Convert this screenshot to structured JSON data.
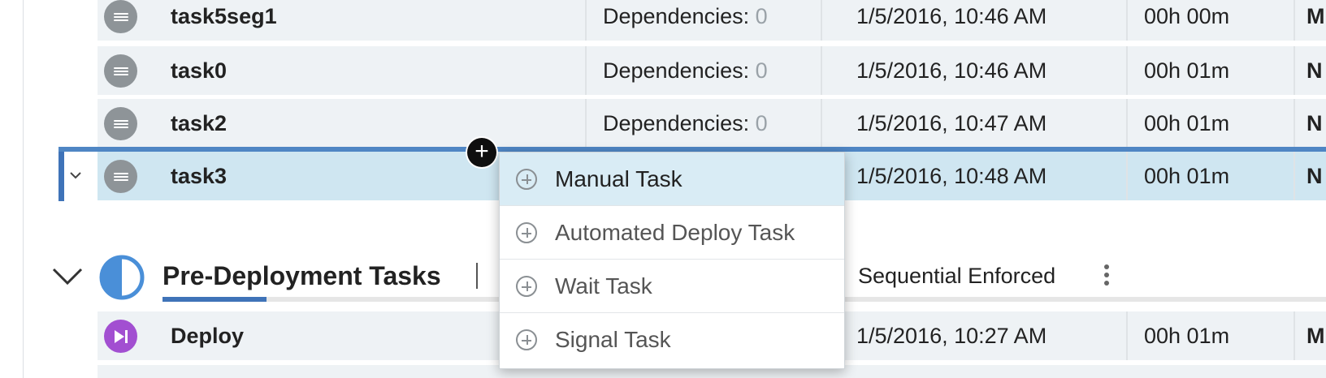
{
  "rows": [
    {
      "name": "task5seg1",
      "dependencies_label": "Dependencies:",
      "dependencies_count": "0",
      "timestamp": "1/5/2016, 10:46 AM",
      "duration": "00h 00m",
      "trailing": "M"
    },
    {
      "name": "task0",
      "dependencies_label": "Dependencies:",
      "dependencies_count": "0",
      "timestamp": "1/5/2016, 10:46 AM",
      "duration": "00h 01m",
      "trailing": "N"
    },
    {
      "name": "task2",
      "dependencies_label": "Dependencies:",
      "dependencies_count": "0",
      "timestamp": "1/5/2016, 10:47 AM",
      "duration": "00h 01m",
      "trailing": "N"
    },
    {
      "name": "task3",
      "timestamp": "1/5/2016, 10:48 AM",
      "duration": "00h 01m",
      "trailing": "N"
    }
  ],
  "group": {
    "title": "Pre-Deployment Tasks",
    "mode": "Sequential Enforced"
  },
  "deploy_row": {
    "name": "Deploy",
    "timestamp": "1/5/2016, 10:27 AM",
    "duration": "00h 01m",
    "trailing": "M"
  },
  "drop_indicator": {
    "symbol": "+"
  },
  "context_menu": {
    "items": [
      {
        "label": "Manual Task"
      },
      {
        "label": "Automated Deploy Task"
      },
      {
        "label": "Wait Task"
      },
      {
        "label": "Signal Task"
      }
    ]
  },
  "colors": {
    "accent": "#3f73b8",
    "row_bg": "#eef2f5",
    "selected_bg": "#cfe6f1",
    "deploy_icon": "#a24fd1"
  }
}
